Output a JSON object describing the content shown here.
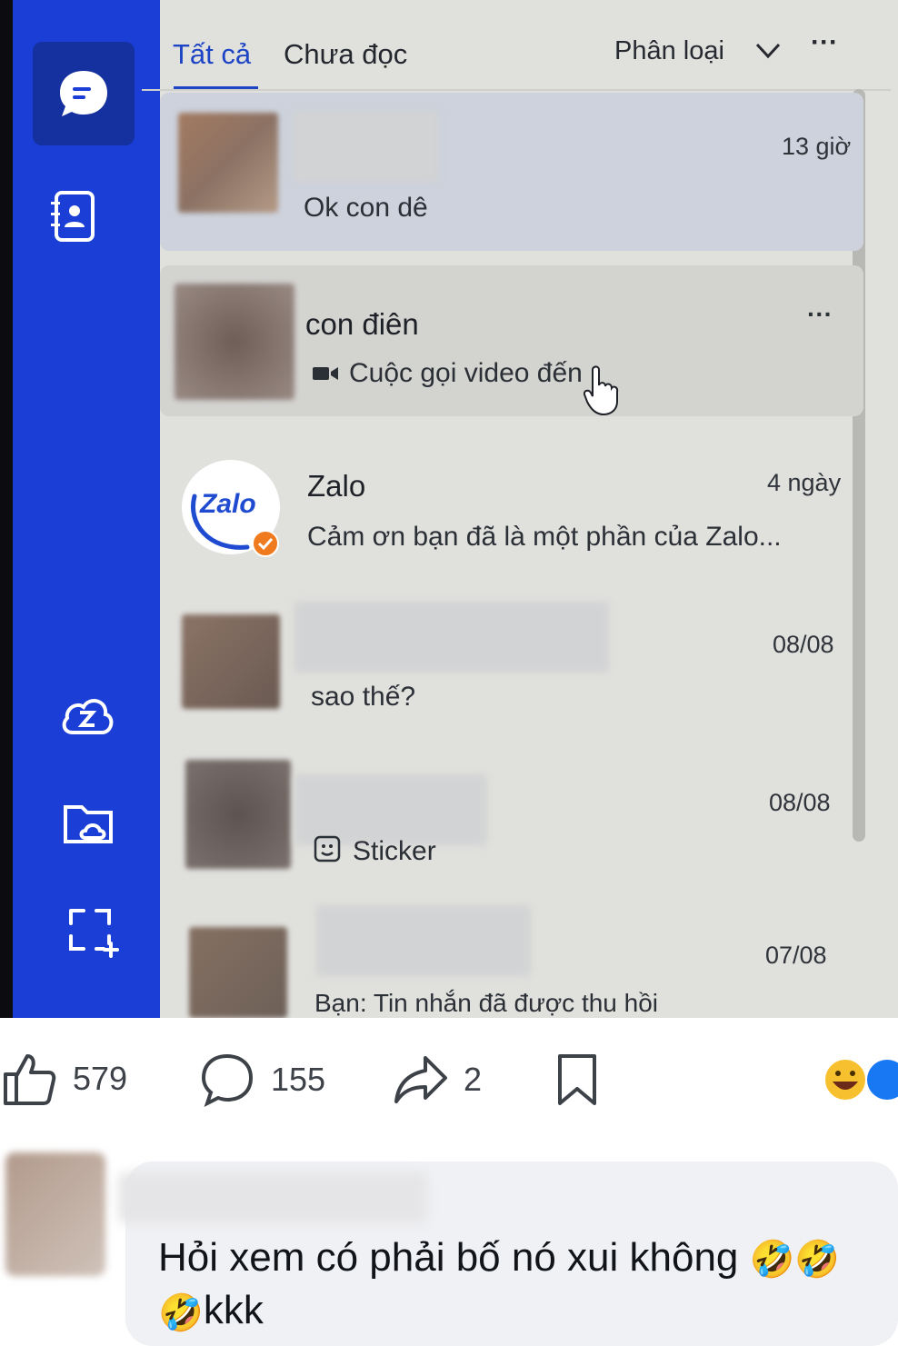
{
  "tabs": {
    "all": "Tất cả",
    "unread": "Chưa đọc"
  },
  "sort": {
    "label": "Phân loại",
    "more": "···"
  },
  "conversations": [
    {
      "name": "",
      "message": "Ok con dê",
      "time": "13 giờ"
    },
    {
      "name": "con điên",
      "message": "Cuộc gọi video đến",
      "time": "",
      "more": "···"
    },
    {
      "name": "Zalo",
      "message": "Cảm ơn bạn đã là một phần của Zalo...",
      "time": "4 ngày",
      "logo": "Zalo"
    },
    {
      "name": "",
      "message": "sao thế?",
      "time": "08/08"
    },
    {
      "name": "",
      "message": "Sticker",
      "time": "08/08"
    },
    {
      "name": "",
      "message": "Bạn: Tin nhắn đã được thu hồi",
      "time": "07/08"
    }
  ],
  "post_actions": {
    "likes": "579",
    "comments": "155",
    "shares": "2"
  },
  "comment": {
    "text": "Hỏi xem có phải bố nó xui không",
    "tail": "kkk"
  },
  "colors": {
    "sidebar": "#1b3fd6",
    "accent": "#1d44c4",
    "background": "#e0e0dd"
  }
}
